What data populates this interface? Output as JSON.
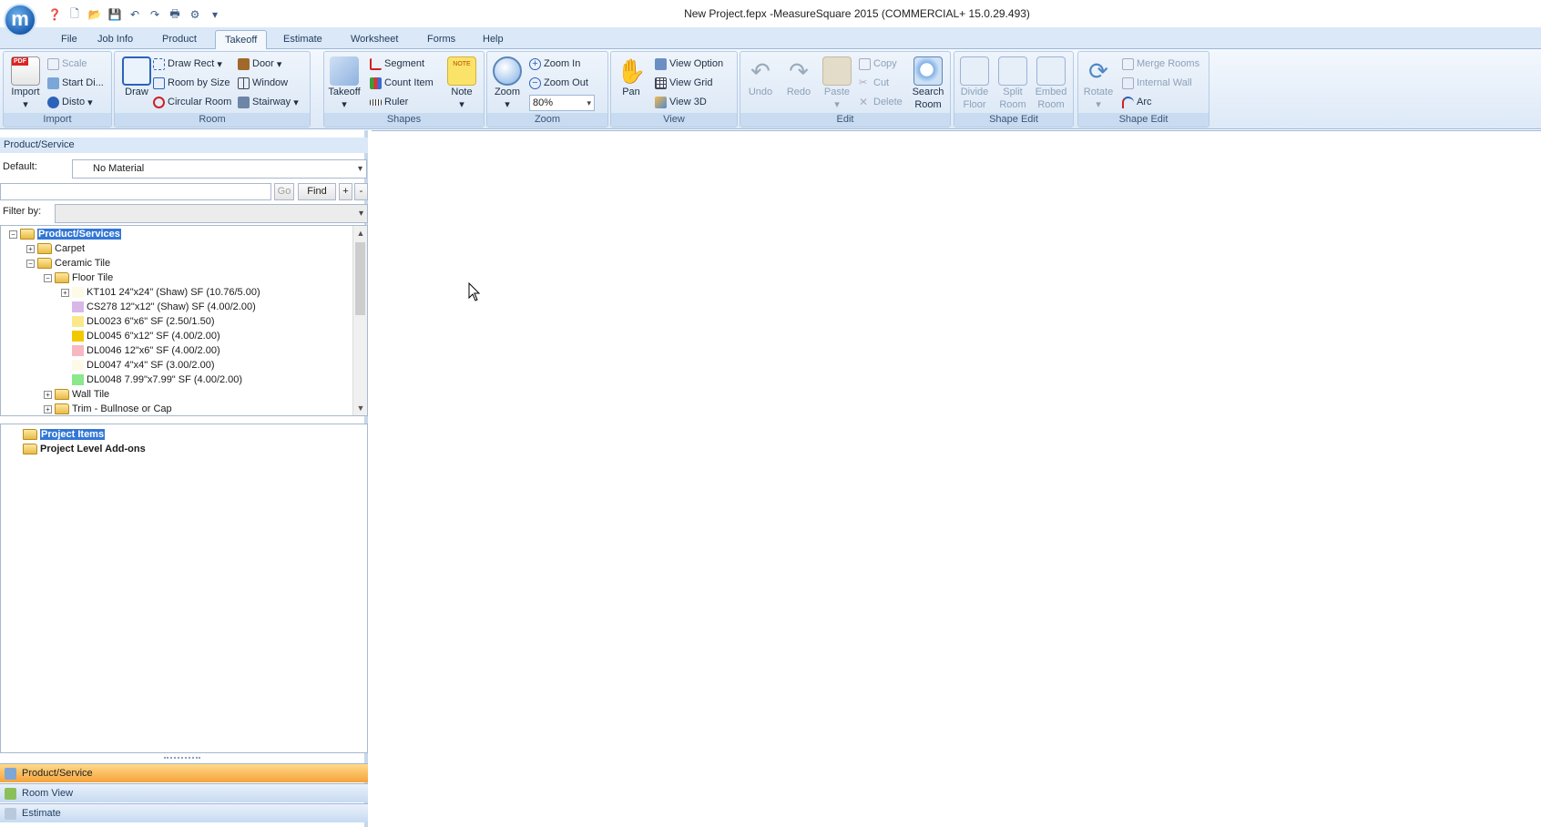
{
  "window": {
    "title": "New Project.fepx -MeasureSquare 2015 (COMMERCIAL+ 15.0.29.493)",
    "app_logo_letter": "m"
  },
  "tabs": [
    "File",
    "Job Info",
    "Product",
    "Takeoff",
    "Estimate",
    "Worksheet",
    "Forms",
    "Help"
  ],
  "active_tab": "Takeoff",
  "ribbon": {
    "import": {
      "label": "Import",
      "import_btn": "Import",
      "scale": "Scale",
      "start_di": "Start Di...",
      "disto": "Disto"
    },
    "room": {
      "label": "Room",
      "draw": "Draw",
      "draw_rect": "Draw Rect",
      "room_by_size": "Room by Size",
      "circular_room": "Circular Room",
      "door": "Door",
      "window": "Window",
      "stairway": "Stairway"
    },
    "shapes": {
      "label": "Shapes",
      "takeoff": "Takeoff",
      "segment": "Segment",
      "count_item": "Count Item",
      "ruler": "Ruler",
      "note": "Note",
      "note_icon_text": "NOTE"
    },
    "zoom": {
      "label": "Zoom",
      "zoom": "Zoom",
      "zoom_in": "Zoom In",
      "zoom_out": "Zoom Out",
      "zoom_value": "80%"
    },
    "view": {
      "label": "View",
      "pan": "Pan",
      "view_option": "View Option",
      "view_grid": "View Grid",
      "view_3d": "View 3D"
    },
    "edit": {
      "label": "Edit",
      "undo": "Undo",
      "redo": "Redo",
      "paste": "Paste",
      "copy": "Copy",
      "cut": "Cut",
      "delete": "Delete",
      "search_room": "Search",
      "search_room2": "Room"
    },
    "shape_edit1": {
      "label": "Shape Edit",
      "divide_floor": "Divide",
      "divide_floor2": "Floor",
      "split_room": "Split",
      "split_room2": "Room",
      "embed_room": "Embed",
      "embed_room2": "Room"
    },
    "shape_edit2": {
      "label": "Shape Edit",
      "rotate": "Rotate",
      "merge_rooms": "Merge Rooms",
      "internal_wall": "Internal Wall",
      "arc": "Arc"
    }
  },
  "product_panel": {
    "header": "Product/Service",
    "default_label": "Default:",
    "default_value": "No Material",
    "search_value": "",
    "go": "Go",
    "find": "Find",
    "plus": "+",
    "minus": "-",
    "filter_label": "Filter by:",
    "filter_value": "",
    "tree": {
      "root": "Product/Services",
      "carpet": "Carpet",
      "ceramic": "Ceramic Tile",
      "floor_tile": "Floor Tile",
      "items": [
        {
          "label": "KT101  24\"x24\" (Shaw) SF (10.76/5.00)",
          "color": "#fdfbe8"
        },
        {
          "label": "CS278  12\"x12\" (Shaw) SF (4.00/2.00)",
          "color": "#d9b8e8"
        },
        {
          "label": "DL0023  6\"x6\" SF (2.50/1.50)",
          "color": "#fbe88a"
        },
        {
          "label": "DL0045  6\"x12\" SF (4.00/2.00)",
          "color": "#f2c900"
        },
        {
          "label": "DL0046  12\"x6\" SF (4.00/2.00)",
          "color": "#f7b8c2"
        },
        {
          "label": "DL0047  4\"x4\" SF (3.00/2.00)",
          "color": "#fdfbe8"
        },
        {
          "label": "DL0048  7.99\"x7.99\" SF (4.00/2.00)",
          "color": "#8be88b"
        }
      ],
      "wall_tile": "Wall Tile",
      "trim": "Trim - Bullnose or Cap"
    },
    "project_tree": {
      "project_items": "Project Items",
      "project_addons": "Project Level Add-ons"
    }
  },
  "nav": {
    "product_service": "Product/Service",
    "room_view": "Room View",
    "estimate": "Estimate"
  }
}
